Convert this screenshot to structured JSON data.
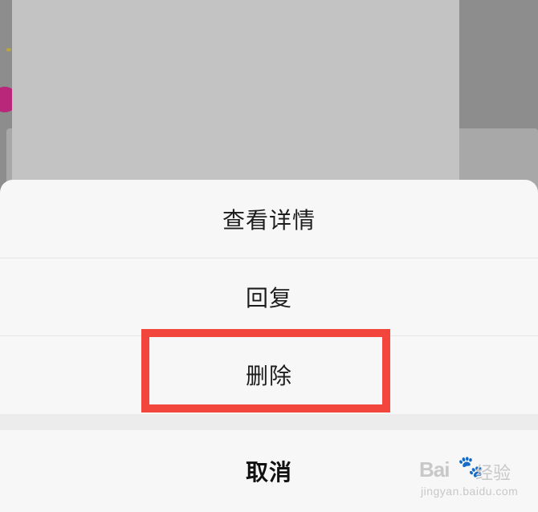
{
  "action_sheet": {
    "items": [
      {
        "label": "查看详情"
      },
      {
        "label": "回复"
      },
      {
        "label": "删除"
      }
    ],
    "cancel_label": "取消"
  },
  "annotation": {
    "highlight_color": "#f2453b",
    "highlighted_item": "删除"
  },
  "watermark": {
    "brand_prefix": "Bai",
    "brand_paw": "🐾",
    "brand_suffix": "经验",
    "url": "jingyan.baidu.com"
  },
  "colors": {
    "sheet_background": "#f7f7f7",
    "overlay": "#8d8d8d",
    "text": "#1d1d1d"
  }
}
